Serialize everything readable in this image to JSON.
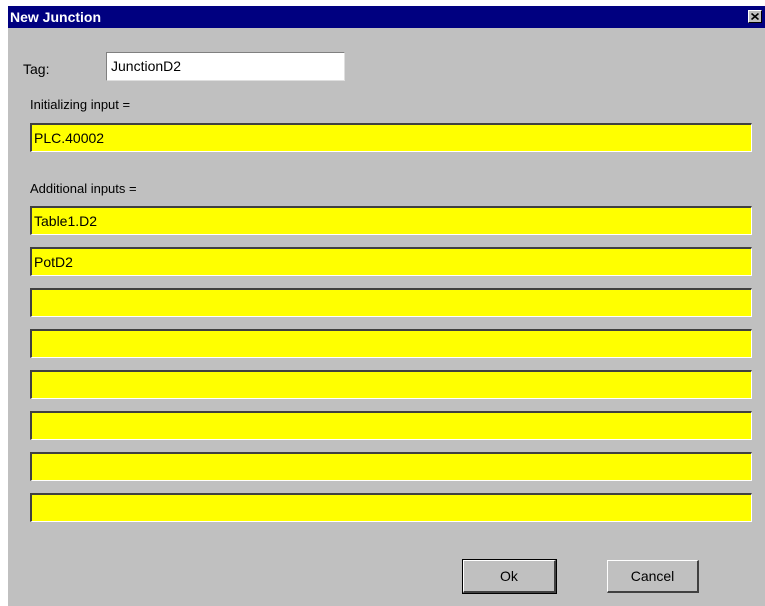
{
  "window": {
    "title": "New Junction"
  },
  "tag": {
    "label": "Tag:",
    "value": "JunctionD2"
  },
  "initializing": {
    "label": "Initializing input =",
    "value": "PLC.40002"
  },
  "additional": {
    "label": "Additional inputs =",
    "values": [
      "Table1.D2",
      "PotD2",
      "",
      "",
      "",
      "",
      "",
      ""
    ]
  },
  "buttons": {
    "ok": "Ok",
    "cancel": "Cancel"
  },
  "colors": {
    "titlebar": "#000080",
    "dialog": "#c0c0c0",
    "field_highlight": "#ffff00"
  },
  "icons": {
    "close": "close-icon"
  }
}
